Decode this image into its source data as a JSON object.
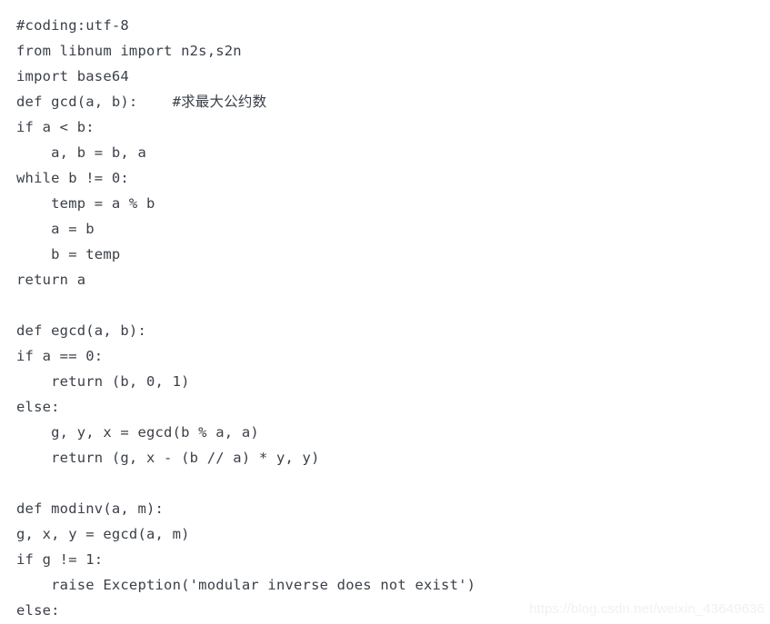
{
  "document": {
    "kind": "code-listing",
    "language": "python",
    "background_color": "#ffffff",
    "text_color": "#3b4049"
  },
  "code": {
    "lines": [
      "#coding:utf-8",
      "from libnum import n2s,s2n",
      "import base64",
      "def gcd(a, b):    #求最大公约数",
      "if a < b:",
      "    a, b = b, a",
      "while b != 0:",
      "    temp = a % b",
      "    a = b",
      "    b = temp",
      "return a",
      "",
      "def egcd(a, b):",
      "if a == 0:",
      "    return (b, 0, 1)",
      "else:",
      "    g, y, x = egcd(b % a, a)",
      "    return (g, x - (b // a) * y, y)",
      "",
      "def modinv(a, m):",
      "g, x, y = egcd(a, m)",
      "if g != 1:",
      "    raise Exception('modular inverse does not exist')",
      "else:"
    ]
  },
  "watermark": {
    "text": "https://blog.csdn.net/weixin_43649636",
    "color": "#f1f1f1"
  }
}
